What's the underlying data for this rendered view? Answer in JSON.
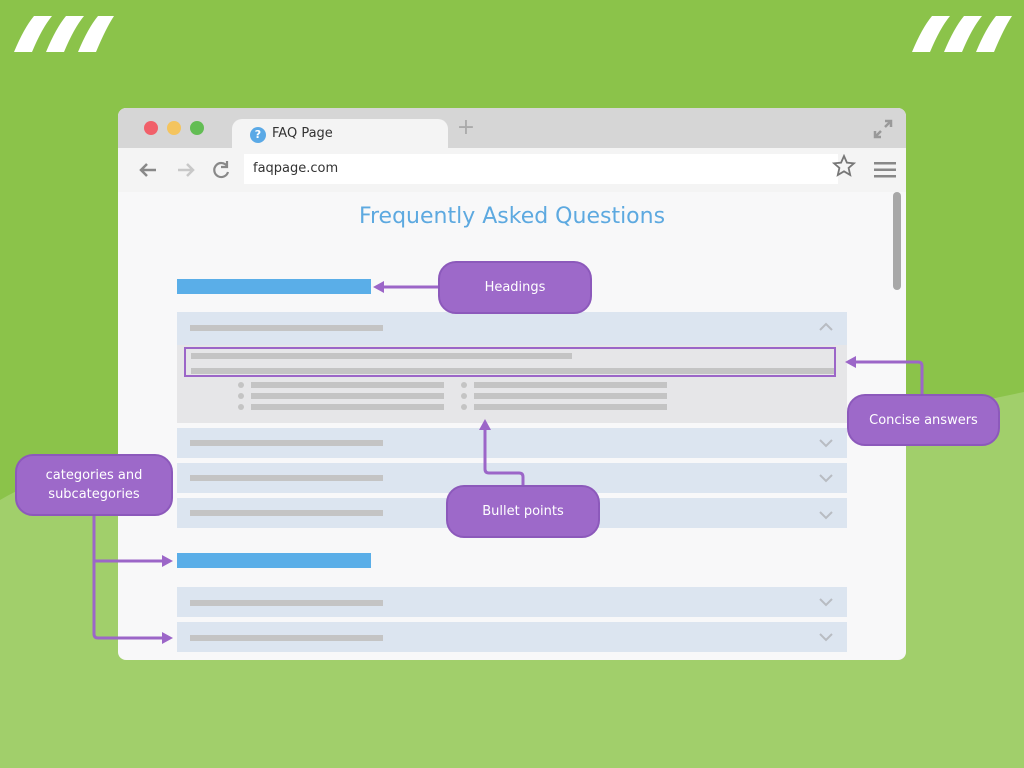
{
  "colors": {
    "background_green": "#8bc34a",
    "background_light_green": "#a1cf6b",
    "callout_purple": "#9d69c9",
    "heading_blue": "#5aaee8",
    "title_blue": "#5da9e0",
    "item_bg": "#dce5f0"
  },
  "browser": {
    "tab": {
      "icon": "question-icon",
      "icon_glyph": "?",
      "title": "FAQ Page",
      "new_tab_glyph": "+"
    },
    "toolbar": {
      "url": "faqpage.com",
      "back_icon": "arrow-left-icon",
      "forward_icon": "arrow-right-icon",
      "reload_icon": "reload-icon",
      "bookmark_icon": "star-icon",
      "menu_icon": "hamburger-icon"
    }
  },
  "page": {
    "title": "Frequently Asked Questions",
    "sections": [
      {
        "heading": "heading-placeholder-1",
        "items": [
          {
            "state": "expanded",
            "has_answer": true,
            "bullet_columns": 2,
            "bullets_per_column": 3
          },
          {
            "state": "collapsed"
          },
          {
            "state": "collapsed"
          },
          {
            "state": "collapsed"
          }
        ]
      },
      {
        "heading": "heading-placeholder-2",
        "items": [
          {
            "state": "collapsed"
          },
          {
            "state": "collapsed"
          }
        ]
      }
    ]
  },
  "callouts": {
    "headings": "Headings",
    "concise_answers": "Concise answers",
    "bullet_points": "Bullet points",
    "categories": "categories and subcategories"
  }
}
